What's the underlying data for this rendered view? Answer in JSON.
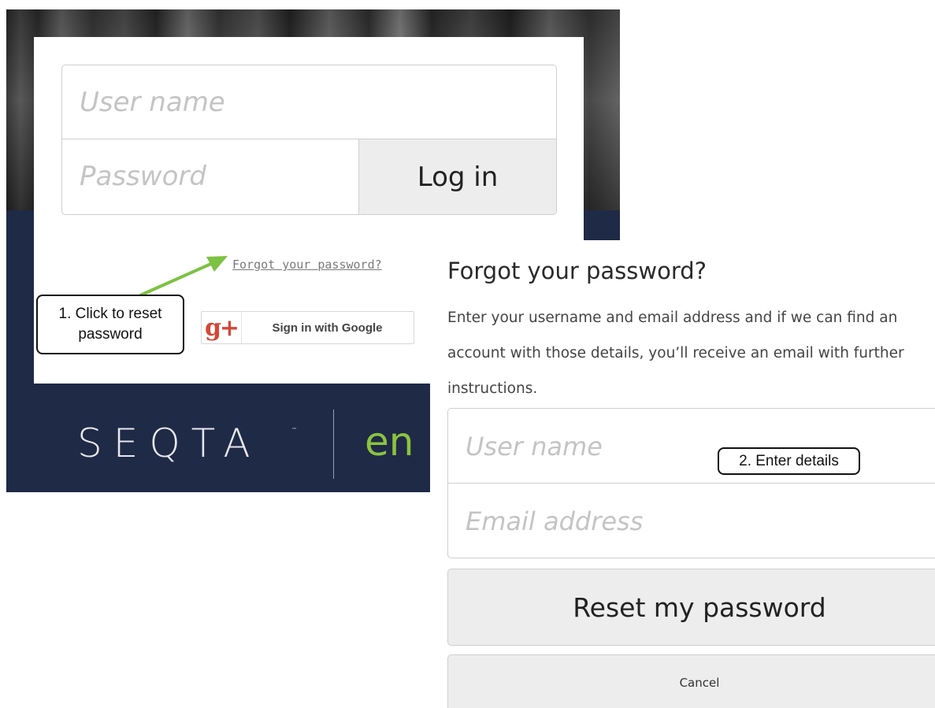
{
  "login": {
    "username_placeholder": "User name",
    "password_placeholder": "Password",
    "login_button": "Log in",
    "forgot_link": "Forgot your password?",
    "google_icon": "g+",
    "google_button": "Sign in with Google",
    "brand_name": "SEQTA",
    "brand_tm": "™",
    "brand_product": "en"
  },
  "forgot": {
    "title": "Forgot your password?",
    "description": "Enter your username and email address and if we can find an account with those details, you’ll receive an email with further instructions.",
    "username_placeholder": "User name",
    "email_placeholder": "Email address",
    "reset_button": "Reset my password",
    "cancel_button": "Cancel"
  },
  "annotations": {
    "step1_line1": "1. Click to reset",
    "step1_line2": "password",
    "step2": "2. Enter details"
  },
  "colors": {
    "navy": "#1f2a47",
    "accent_green": "#8ac43f",
    "arrow_green": "#7dc242",
    "google_red": "#d34836"
  }
}
